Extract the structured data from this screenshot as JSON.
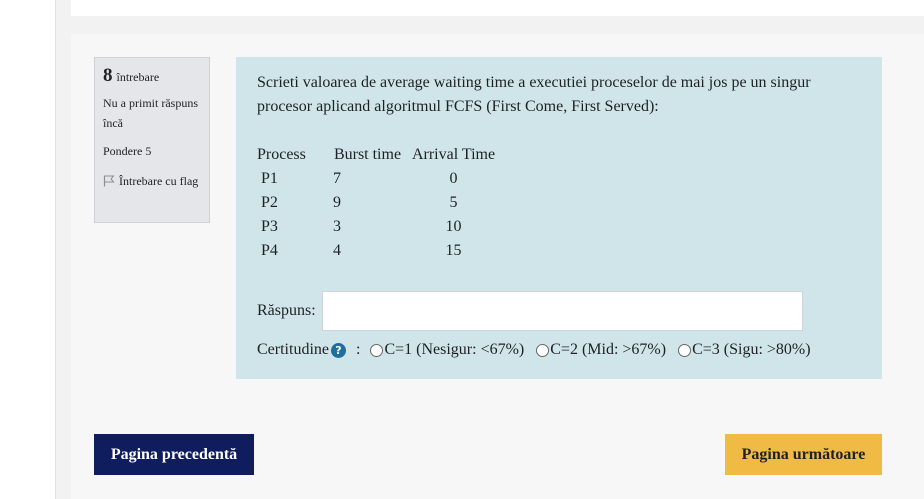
{
  "question": {
    "number": "8",
    "word": "întrebare",
    "state": "Nu a primit răspuns încă",
    "grade": "Pondere 5",
    "flag_label": "Întrebare cu flag",
    "text": "Scrieti valoarea de average waiting time a executiei proceselor de mai jos pe un singur procesor aplicand algoritmul FCFS (First Come, First Served):",
    "table": {
      "headers": [
        "Process",
        "Burst time",
        "Arrival Time"
      ],
      "rows": [
        [
          "P1",
          "7",
          "0"
        ],
        [
          "P2",
          "9",
          "5"
        ],
        [
          "P3",
          "3",
          "10"
        ],
        [
          "P4",
          "4",
          "15"
        ]
      ]
    },
    "answer_label": "Răspuns:",
    "answer_value": "",
    "certainty_label": "Certitudine",
    "certainty_sep": ":",
    "certainty_options": [
      "C=1 (Nesigur: <67%)",
      "C=2 (Mid: >67%)",
      "C=3 (Sigu: >80%)"
    ]
  },
  "nav": {
    "prev_label": "Pagina precedentă",
    "next_label": "Pagina următoare"
  },
  "colors": {
    "content_bg": "#d0e5ea",
    "info_bg": "#e4e6ea",
    "prev_button": "#0f1d5e",
    "next_button": "#f0bb44",
    "help_icon": "#1f6f9c"
  },
  "icons": {
    "flag": "flag-icon",
    "help": "question-circle-icon"
  }
}
